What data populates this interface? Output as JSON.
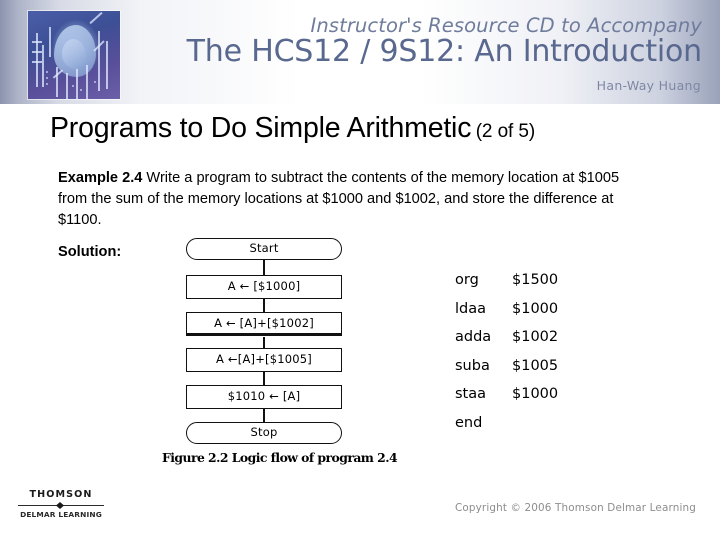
{
  "banner": {
    "superline": "Instructor's Resource CD to Accompany",
    "title": "The HCS12 / 9S12: An Introduction",
    "author": "Han-Way Huang",
    "photo_alt": "circuit-board-face-graphic"
  },
  "slide": {
    "title_main": "Programs to Do Simple Arithmetic",
    "title_sub": "(2 of 5)",
    "example_label": "Example 2.4",
    "example_text": " Write a program to subtract the contents of the memory location at $1005 from the sum of the memory locations at $1000 and $1002, and store the difference at $1100.",
    "solution_label": "Solution:"
  },
  "flowchart": {
    "start": "Start",
    "step1": "A ← [$1000]",
    "step2": "A ← [A]+[$1002]",
    "step3": "A ←[A]+[$1005]",
    "step4": "$1010 ← [A]",
    "stop": "Stop",
    "caption": "Figure 2.2 Logic flow of program 2.4"
  },
  "code": {
    "lines": [
      {
        "mnemonic": "org",
        "operand": "$1500"
      },
      {
        "mnemonic": "ldaa",
        "operand": "$1000"
      },
      {
        "mnemonic": "adda",
        "operand": "$1002"
      },
      {
        "mnemonic": "suba",
        "operand": "$1005"
      },
      {
        "mnemonic": "staa",
        "operand": "$1000"
      },
      {
        "mnemonic": "end",
        "operand": ""
      }
    ]
  },
  "footer": {
    "logo_top": "THOMSON",
    "logo_bottom": "DELMAR LEARNING",
    "copyright": "Copyright © 2006 Thomson Delmar Learning"
  },
  "colors": {
    "banner_title": "#59688f",
    "banner_superline": "#6f7c9c",
    "copyright": "#8d8d8d"
  }
}
